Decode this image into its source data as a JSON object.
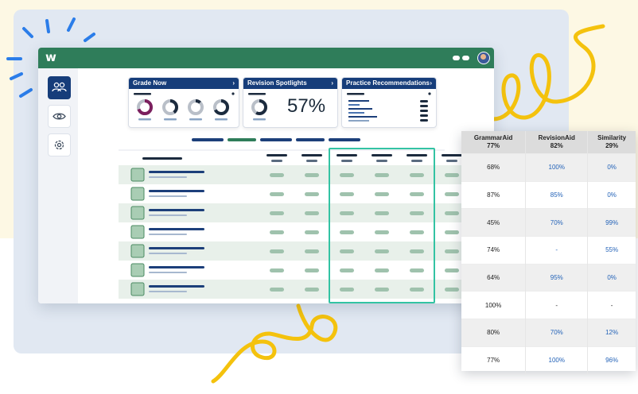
{
  "window": {
    "logo": "w"
  },
  "cards": {
    "grade_now": {
      "title": "Grade Now",
      "chevron": "›"
    },
    "revision_spotlights": {
      "title": "Revision Spotlights",
      "chevron": "›",
      "percent": "57%"
    },
    "practice_recommendations": {
      "title": "Practice Recommendations",
      "chevron": "›"
    }
  },
  "sidebar": {
    "items": [
      {
        "icon": "people-icon",
        "active": true
      },
      {
        "icon": "eye-icon",
        "active": false
      },
      {
        "icon": "gear-icon",
        "active": false
      }
    ]
  },
  "comparison_table": {
    "headers": [
      {
        "name": "GrammarAid",
        "pct": "77%"
      },
      {
        "name": "RevisionAid",
        "pct": "82%"
      },
      {
        "name": "Similarity",
        "pct": "29%"
      }
    ],
    "rows": [
      [
        "68%",
        "100%",
        "0%"
      ],
      [
        "87%",
        "85%",
        "0%"
      ],
      [
        "45%",
        "70%",
        "99%"
      ],
      [
        "74%",
        "-",
        "55%"
      ],
      [
        "64%",
        "95%",
        "0%"
      ],
      [
        "100%",
        "-",
        "-"
      ],
      [
        "80%",
        "70%",
        "12%"
      ],
      [
        "77%",
        "100%",
        "96%"
      ]
    ]
  },
  "colors": {
    "brand_green": "#2f7d5a",
    "navy": "#163d7a",
    "highlight_teal": "#33c3a3",
    "value_blue": "#2463b8",
    "donut_purple": "#7b1f5e"
  }
}
